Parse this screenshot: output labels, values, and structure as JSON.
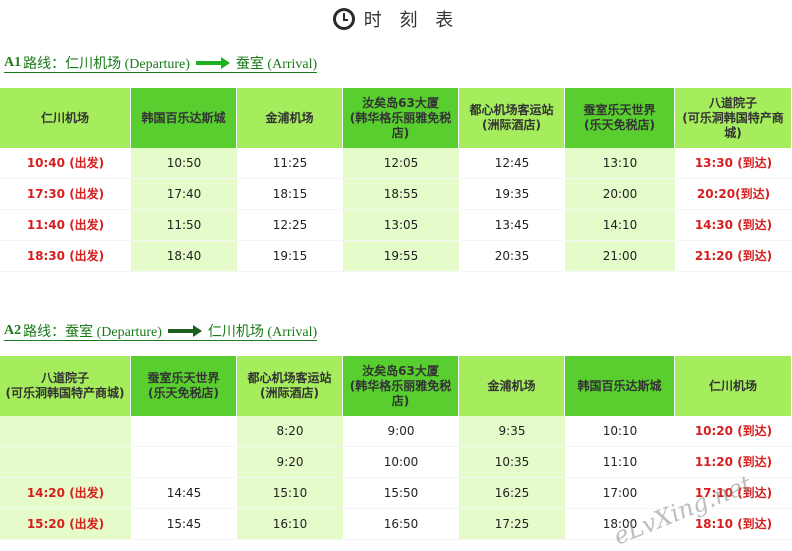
{
  "page": {
    "title": "时 刻 表",
    "icon": "clock-icon"
  },
  "routes": [
    {
      "code": "A1",
      "label": "路线：仁川机场 (Departure)",
      "destination": "蚕室 (Arrival)",
      "headers": [
        "仁川机场",
        "韩国百乐达斯城",
        "金浦机场",
        "汝矣岛63大厦\n(韩华格乐丽雅免税店)",
        "都心机场客运站\n(洲际酒店)",
        "蚕室乐天世界\n(乐天免税店)",
        "八道院子\n(可乐洞韩国特产商城)"
      ],
      "rows": [
        [
          "10:40 (出发)",
          "10:50",
          "11:25",
          "12:05",
          "12:45",
          "13:10",
          "13:30 (到达)"
        ],
        [
          "17:30 (出发)",
          "17:40",
          "18:15",
          "18:55",
          "19:35",
          "20:00",
          "20:20(到达)"
        ],
        [
          "11:40 (出发)",
          "11:50",
          "12:25",
          "13:05",
          "13:45",
          "14:10",
          "14:30 (到达)"
        ],
        [
          "18:30 (出发)",
          "18:40",
          "19:15",
          "19:55",
          "20:35",
          "21:00",
          "21:20 (到达)"
        ]
      ]
    },
    {
      "code": "A2",
      "label": "路线：蚕室 (Departure)",
      "destination": "仁川机场 (Arrival)",
      "headers": [
        "八道院子\n(可乐洞韩国特产商城)",
        "蚕室乐天世界\n(乐天免税店)",
        "都心机场客运站\n(洲际酒店)",
        "汝矣岛63大厦\n(韩华格乐丽雅免税店)",
        "金浦机场",
        "韩国百乐达斯城",
        "仁川机场"
      ],
      "rows": [
        [
          "",
          "",
          "8:20",
          "9:00",
          "9:35",
          "10:10",
          "10:20 (到达)"
        ],
        [
          "",
          "",
          "9:20",
          "10:00",
          "10:35",
          "11:10",
          "11:20 (到达)"
        ],
        [
          "14:20 (出发)",
          "14:45",
          "15:10",
          "15:50",
          "16:25",
          "17:00",
          "17:10 (到达)"
        ],
        [
          "15:20 (出发)",
          "15:45",
          "16:10",
          "16:50",
          "17:25",
          "18:00",
          "18:10 (到达)"
        ]
      ]
    }
  ],
  "watermark": "eLvXing.net",
  "colors": {
    "header_light": "#a6ed5d",
    "header_dark": "#58cf2e",
    "cell_alt": "#e5fbc9",
    "accent_red": "#d71e1e",
    "route_green": "#1a7a1a",
    "arrow_green": "#1db21d"
  }
}
